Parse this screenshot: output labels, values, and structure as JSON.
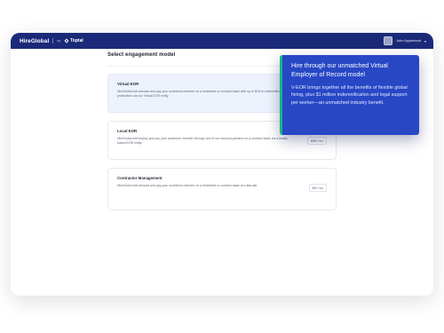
{
  "header": {
    "brand": "HireGlobal",
    "by": "by",
    "partner": "Toptal",
    "user_name": "John Applewood"
  },
  "main": {
    "title": "Select engagement model",
    "cards": [
      {
        "title": "Virtual EOR",
        "description": "HireGlobal will onboard and pay your workforce member on a timesheet or contract basis with up to $1M in indemnification protections via our Virtual EOR entity.",
        "price": ""
      },
      {
        "title": "Local EOR",
        "description": "HireGlobal will employ and pay your workforce member through one of our network partners on a contract basis via a locally based EOR entity.",
        "price": "$399 / mo"
      },
      {
        "title": "Contractor Management",
        "description": "HireGlobal will onboard and pay your workforce member on a timesheet or contract basis at a flat rate.",
        "price": "$29 / mo"
      }
    ]
  },
  "tooltip": {
    "title": "Hire through our unmatched Virtual Employer of Record model",
    "body": "V-EOR brings together all the benefits of flexible global hiring, plus $1 million indemnification and legal support per worker—an unmatched industry benefit."
  },
  "colors": {
    "header_bg": "#1b2a78",
    "tooltip_bg": "#2747c5",
    "tooltip_accent": "#12b982",
    "active_card_bg": "#eef2fd"
  }
}
